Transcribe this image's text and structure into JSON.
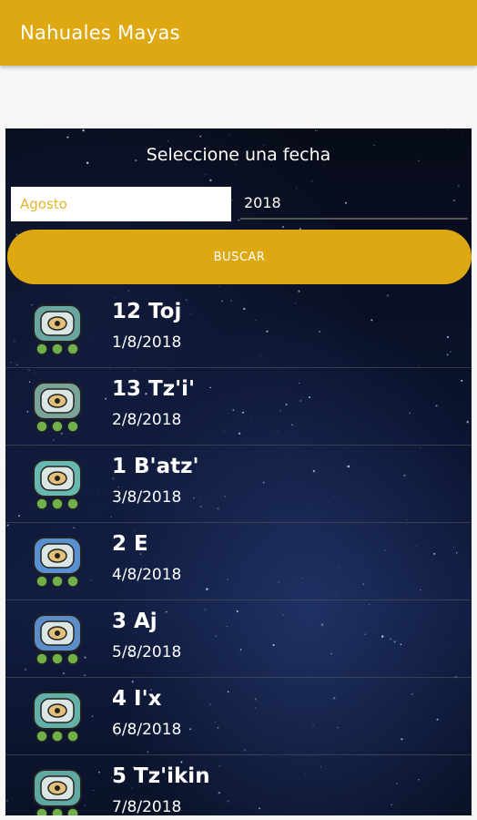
{
  "app": {
    "title": "Nahuales Mayas"
  },
  "form": {
    "heading": "Seleccione una fecha",
    "month_value": "Agosto",
    "year_value": "2018",
    "search_label": "BUSCAR"
  },
  "nahuales": [
    {
      "title": "12 Toj",
      "date": "1/8/2018",
      "icon": "toj-glyph-icon",
      "color": "#6aa6a0"
    },
    {
      "title": "13 Tz'i'",
      "date": "2/8/2018",
      "icon": "tzi-glyph-icon",
      "color": "#7aa39a"
    },
    {
      "title": "1 B'atz'",
      "date": "3/8/2018",
      "icon": "batz-glyph-icon",
      "color": "#67b8b0"
    },
    {
      "title": "2 E",
      "date": "4/8/2018",
      "icon": "e-glyph-icon",
      "color": "#5a8fd0"
    },
    {
      "title": "3 Aj",
      "date": "5/8/2018",
      "icon": "aj-glyph-icon",
      "color": "#5b8ec9"
    },
    {
      "title": "4 I'x",
      "date": "6/8/2018",
      "icon": "ix-glyph-icon",
      "color": "#62b0a8"
    },
    {
      "title": "5 Tz'ikin",
      "date": "7/8/2018",
      "icon": "tzikin-glyph-icon",
      "color": "#5fa9a2"
    }
  ]
}
